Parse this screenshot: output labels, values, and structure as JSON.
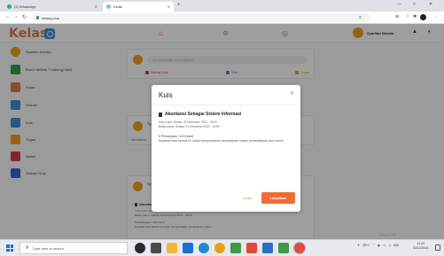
{
  "browser": {
    "tabs": [
      {
        "label": "(2) WhatsApp",
        "active": false
      },
      {
        "label": "Kelas",
        "active": true
      }
    ],
    "new_tab_symbol": "+",
    "window_controls": [
      "—",
      "□",
      "✕"
    ],
    "url": "kelasq.com"
  },
  "app": {
    "logo_text": "Kelas",
    "user_name": "Syarifan Nubala",
    "nav_icons": [
      "home-icon",
      "gamepad-icon",
      "chat-icon"
    ],
    "accent": "#ef6d34"
  },
  "sidebar": {
    "items": [
      {
        "label": "Syarifan Nubala",
        "icon": "avatar-icon",
        "color": "#f0a020"
      },
      {
        "label": "Buruh tertinta 7 hubungi kami",
        "icon": "group-icon",
        "color": "#30a24a"
      },
      {
        "label": "Kelas",
        "icon": "class-icon",
        "color": "#e07a4a"
      },
      {
        "label": "Diskusi",
        "icon": "discussion-icon",
        "color": "#3b8fd8"
      },
      {
        "label": "Kuis",
        "icon": "quiz-icon",
        "color": "#3b8fd8"
      },
      {
        "label": "Tugas",
        "icon": "task-icon",
        "color": "#f0a020"
      },
      {
        "label": "Materi",
        "icon": "material-icon",
        "color": "#d83b3b"
      },
      {
        "label": "Diskusi Grup",
        "icon": "group-chat-icon",
        "color": "#3b5fd8"
      }
    ]
  },
  "composer": {
    "placeholder": "Apa yang ingin kamu bagikan",
    "actions": [
      {
        "label": "Diskusi Grup",
        "color": "#d83b3b"
      },
      {
        "label": "Kuis",
        "color": "#3b8fd8"
      },
      {
        "label": "Tugas",
        "color": "#f0a020"
      }
    ]
  },
  "feed_post_1": {
    "author": "Sy",
    "sub": "Akuntansi"
  },
  "feed_post_2": {
    "author": "Sy",
    "title": "Akuntansi Sebagai Sistem Informasi",
    "start": "Kuis mulai: Selasa, 30 Desember 2021 - 20:00",
    "end": "Batas waktu: Selasa, 31 Desember 2021 - 23:59",
    "count": "5 Pertanyaan / 120 menit",
    "desc": "Kerjakan kuis berikut ini untuk memperdalam pemahaman materi"
  },
  "page_footer": "Kelasq © 2021",
  "modal": {
    "title": "Kuis",
    "close_symbol": "✕",
    "quiz_title": "Akuntansi Sebagai Sistem Informasi",
    "start": "Kuis mulai: Selasa, 30 Desember 2021 - 20:00",
    "end": "Batas waktu: Selasa, 31 Desember 2021 - 23:59",
    "count": "5 Pertanyaan / 120 menit",
    "desc": "Kerjakan kuis berikut ini untuk memperdalam pemahaman materi pembelajaran dari modul",
    "cancel_label": "Close",
    "start_label": "Lanjutkan"
  },
  "taskbar": {
    "search_placeholder": "Type here to search",
    "apps": [
      {
        "name": "cortana-icon",
        "color": "#2b2b2b"
      },
      {
        "name": "task-view-icon",
        "color": "#4a4a4a"
      },
      {
        "name": "file-explorer-icon",
        "color": "#f2b53a"
      },
      {
        "name": "store-icon",
        "color": "#1f6fd1"
      },
      {
        "name": "edge-icon",
        "color": "#1e8bd6"
      },
      {
        "name": "chrome-icon",
        "color": "#e5a313"
      },
      {
        "name": "app-icon-1",
        "color": "#3c9a48"
      },
      {
        "name": "app-icon-2",
        "color": "#e04a3a"
      },
      {
        "name": "app-icon-3",
        "color": "#2a6fc4"
      },
      {
        "name": "app-icon-4",
        "color": "#3c9a48"
      },
      {
        "name": "chrome-active-icon",
        "color": "#e04a3a"
      }
    ],
    "temperature": "28°C",
    "lang": "IND",
    "time": "11:23",
    "date": "31/12/2021"
  }
}
